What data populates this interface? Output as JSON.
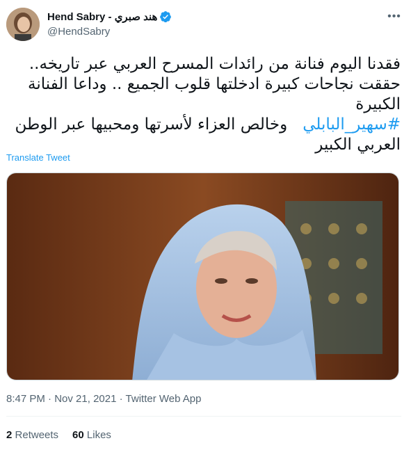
{
  "author": {
    "display_name": "Hend Sabry - هند صبري",
    "handle": "@HendSabry",
    "verified": true,
    "avatar_icon": "profile-photo"
  },
  "tweet": {
    "lines": [
      "فقدنا اليوم فنانة من رائدات المسرح العربي عبر تاريخه..",
      "حققت نجاحات كبيرة ادخلتها قلوب الجميع .. وداعا الفنانة",
      "الكبيرة"
    ],
    "hashtag": "#سهير_البابلي",
    "line_after_hashtag": "وخالص العزاء لأسرتها ومحبيها عبر الوطن",
    "last_line": "العربي الكبير"
  },
  "translate_label": "Translate Tweet",
  "meta": {
    "time": "8:47 PM",
    "date": "Nov 21, 2021",
    "source": "Twitter Web App",
    "sep": "·"
  },
  "stats": {
    "retweets_count": "2",
    "retweets_label": "Retweets",
    "likes_count": "60",
    "likes_label": "Likes"
  },
  "colors": {
    "accent": "#1d9bf0",
    "secondary_text": "#536471",
    "primary_text": "#0f1419"
  }
}
